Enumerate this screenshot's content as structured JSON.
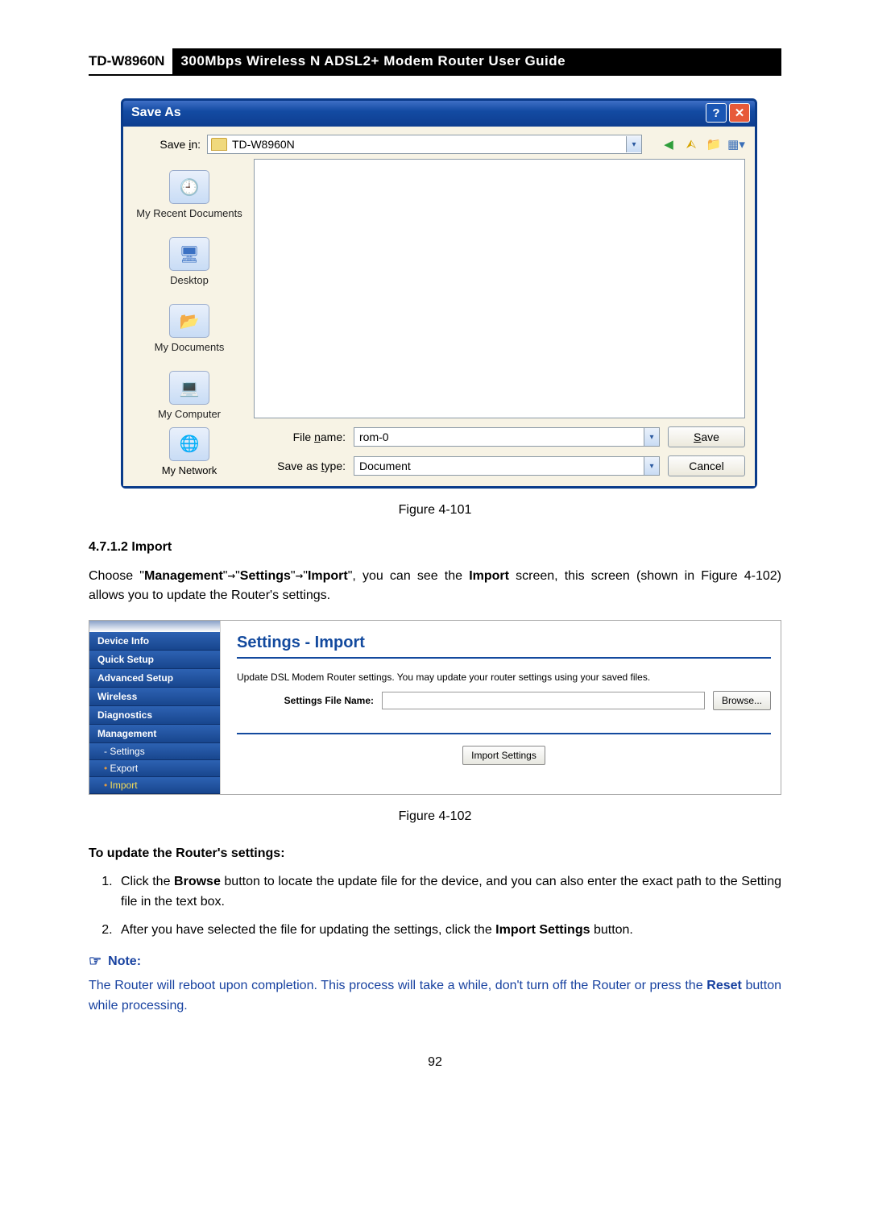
{
  "header": {
    "model": "TD-W8960N",
    "title": "300Mbps Wireless N ADSL2+ Modem Router User Guide"
  },
  "saveas": {
    "window_title": "Save As",
    "save_in_label": "Save in:",
    "save_in_value": "TD-W8960N",
    "places": {
      "recent": "My Recent Documents",
      "desktop": "Desktop",
      "mydocs": "My Documents",
      "mycomp": "My Computer",
      "mynet": "My Network"
    },
    "file_name_label": "File name:",
    "file_name_value": "rom-0",
    "save_as_type_label": "Save as type:",
    "save_as_type_value": "Document",
    "save_btn": "Save",
    "cancel_btn": "Cancel",
    "toolbar_icons": [
      "back-icon",
      "up-icon",
      "new-folder-icon",
      "views-icon"
    ]
  },
  "fig1": "Figure 4-101",
  "section_num": "4.7.1.2  Import",
  "intro": {
    "pre": "Choose \"",
    "mgmt": "Management",
    "arrow": "→",
    "settings": "Settings",
    "import": "Import",
    "mid1": "\", you can see the ",
    "import2": "Import",
    "mid2": " screen, this screen (shown in Figure 4-102) allows you to update the Router's settings."
  },
  "router": {
    "side": {
      "device_info": "Device Info",
      "quick_setup": "Quick Setup",
      "advanced_setup": "Advanced Setup",
      "wireless": "Wireless",
      "diagnostics": "Diagnostics",
      "management": "Management",
      "settings": "Settings",
      "export": "Export",
      "import": "Import"
    },
    "main": {
      "heading": "Settings - Import",
      "desc": "Update DSL Modem Router settings. You may update your router settings using your saved files.",
      "file_label": "Settings File Name:",
      "browse_btn": "Browse...",
      "import_btn": "Import Settings"
    }
  },
  "fig2": "Figure 4-102",
  "update_h": "To update the Router's settings:",
  "steps": {
    "s1a": "Click the ",
    "s1b": "Browse",
    "s1c": " button to locate the update file for the device, and you can also enter the exact path to the Setting file in the text box.",
    "s2a": "After you have selected the file for updating the settings, click the ",
    "s2b": "Import Settings",
    "s2c": " button."
  },
  "note": {
    "heading": "Note:",
    "body_a": "The Router will reboot upon completion. This process will take a while, don't turn off the Router or press the ",
    "body_b": "Reset",
    "body_c": " button while processing."
  },
  "page_number": "92"
}
